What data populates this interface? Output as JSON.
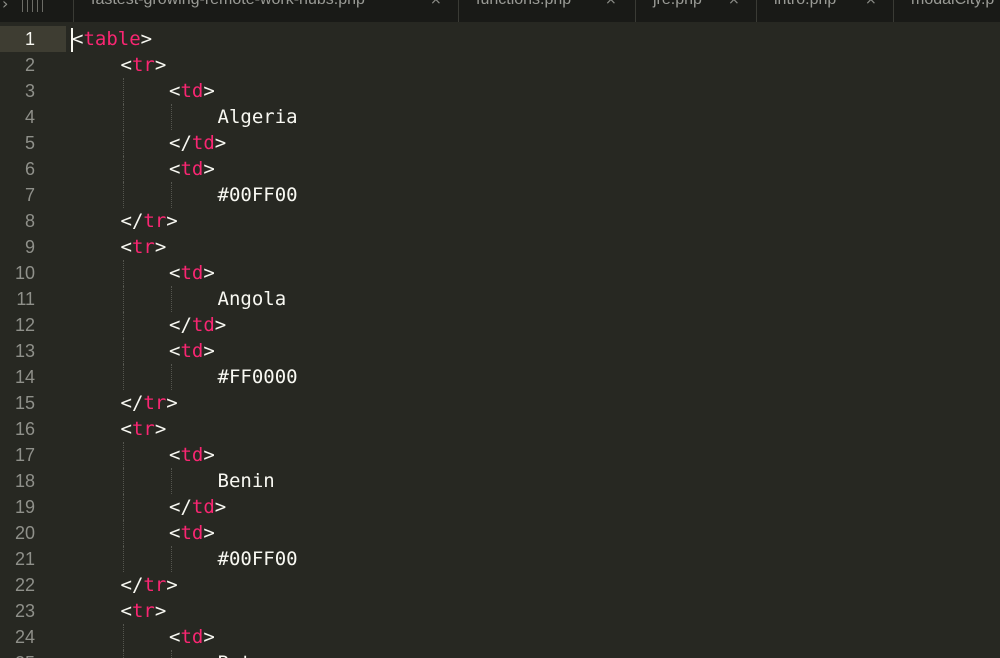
{
  "tabs": [
    {
      "label": "fastest-growing-remote-work-hubs.php",
      "close": "×"
    },
    {
      "label": "functions.php",
      "close": "×"
    },
    {
      "label": "jre.php",
      "close": "×"
    },
    {
      "label": "intro.php",
      "close": "×"
    },
    {
      "label": "modalCity.p",
      "close": ""
    }
  ],
  "tabbar": {
    "scroll_left_glyph": "›"
  },
  "editor": {
    "current_line": 1,
    "colors": {
      "background": "#272822",
      "tag": "#f92672",
      "text": "#f8f8f2",
      "gutter_text": "#8f908a"
    },
    "lines": [
      {
        "n": "1",
        "indent": 0,
        "segments": [
          {
            "t": "<",
            "c": "p"
          },
          {
            "t": "table",
            "c": "tag"
          },
          {
            "t": ">",
            "c": "p"
          }
        ]
      },
      {
        "n": "2",
        "indent": 1,
        "segments": [
          {
            "t": "<",
            "c": "p"
          },
          {
            "t": "tr",
            "c": "tag"
          },
          {
            "t": ">",
            "c": "p"
          }
        ]
      },
      {
        "n": "3",
        "indent": 2,
        "segments": [
          {
            "t": "<",
            "c": "p"
          },
          {
            "t": "td",
            "c": "tag"
          },
          {
            "t": ">",
            "c": "p"
          }
        ]
      },
      {
        "n": "4",
        "indent": 3,
        "segments": [
          {
            "t": "Algeria",
            "c": "p"
          }
        ]
      },
      {
        "n": "5",
        "indent": 2,
        "segments": [
          {
            "t": "</",
            "c": "p"
          },
          {
            "t": "td",
            "c": "tag"
          },
          {
            "t": ">",
            "c": "p"
          }
        ]
      },
      {
        "n": "6",
        "indent": 2,
        "segments": [
          {
            "t": "<",
            "c": "p"
          },
          {
            "t": "td",
            "c": "tag"
          },
          {
            "t": ">",
            "c": "p"
          }
        ]
      },
      {
        "n": "7",
        "indent": 3,
        "segments": [
          {
            "t": "#00FF00",
            "c": "p"
          }
        ]
      },
      {
        "n": "8",
        "indent": 1,
        "segments": [
          {
            "t": "</",
            "c": "p"
          },
          {
            "t": "tr",
            "c": "tag"
          },
          {
            "t": ">",
            "c": "p"
          }
        ]
      },
      {
        "n": "9",
        "indent": 1,
        "segments": [
          {
            "t": "<",
            "c": "p"
          },
          {
            "t": "tr",
            "c": "tag"
          },
          {
            "t": ">",
            "c": "p"
          }
        ]
      },
      {
        "n": "10",
        "indent": 2,
        "segments": [
          {
            "t": "<",
            "c": "p"
          },
          {
            "t": "td",
            "c": "tag"
          },
          {
            "t": ">",
            "c": "p"
          }
        ]
      },
      {
        "n": "11",
        "indent": 3,
        "segments": [
          {
            "t": "Angola",
            "c": "p"
          }
        ]
      },
      {
        "n": "12",
        "indent": 2,
        "segments": [
          {
            "t": "</",
            "c": "p"
          },
          {
            "t": "td",
            "c": "tag"
          },
          {
            "t": ">",
            "c": "p"
          }
        ]
      },
      {
        "n": "13",
        "indent": 2,
        "segments": [
          {
            "t": "<",
            "c": "p"
          },
          {
            "t": "td",
            "c": "tag"
          },
          {
            "t": ">",
            "c": "p"
          }
        ]
      },
      {
        "n": "14",
        "indent": 3,
        "segments": [
          {
            "t": "#FF0000",
            "c": "p"
          }
        ]
      },
      {
        "n": "15",
        "indent": 1,
        "segments": [
          {
            "t": "</",
            "c": "p"
          },
          {
            "t": "tr",
            "c": "tag"
          },
          {
            "t": ">",
            "c": "p"
          }
        ]
      },
      {
        "n": "16",
        "indent": 1,
        "segments": [
          {
            "t": "<",
            "c": "p"
          },
          {
            "t": "tr",
            "c": "tag"
          },
          {
            "t": ">",
            "c": "p"
          }
        ]
      },
      {
        "n": "17",
        "indent": 2,
        "segments": [
          {
            "t": "<",
            "c": "p"
          },
          {
            "t": "td",
            "c": "tag"
          },
          {
            "t": ">",
            "c": "p"
          }
        ]
      },
      {
        "n": "18",
        "indent": 3,
        "segments": [
          {
            "t": "Benin",
            "c": "p"
          }
        ]
      },
      {
        "n": "19",
        "indent": 2,
        "segments": [
          {
            "t": "</",
            "c": "p"
          },
          {
            "t": "td",
            "c": "tag"
          },
          {
            "t": ">",
            "c": "p"
          }
        ]
      },
      {
        "n": "20",
        "indent": 2,
        "segments": [
          {
            "t": "<",
            "c": "p"
          },
          {
            "t": "td",
            "c": "tag"
          },
          {
            "t": ">",
            "c": "p"
          }
        ]
      },
      {
        "n": "21",
        "indent": 3,
        "segments": [
          {
            "t": "#00FF00",
            "c": "p"
          }
        ]
      },
      {
        "n": "22",
        "indent": 1,
        "segments": [
          {
            "t": "</",
            "c": "p"
          },
          {
            "t": "tr",
            "c": "tag"
          },
          {
            "t": ">",
            "c": "p"
          }
        ]
      },
      {
        "n": "23",
        "indent": 1,
        "segments": [
          {
            "t": "<",
            "c": "p"
          },
          {
            "t": "tr",
            "c": "tag"
          },
          {
            "t": ">",
            "c": "p"
          }
        ]
      },
      {
        "n": "24",
        "indent": 2,
        "segments": [
          {
            "t": "<",
            "c": "p"
          },
          {
            "t": "td",
            "c": "tag"
          },
          {
            "t": ">",
            "c": "p"
          }
        ]
      },
      {
        "n": "25",
        "indent": 3,
        "segments": [
          {
            "t": "Botswana",
            "c": "p"
          }
        ]
      }
    ]
  }
}
